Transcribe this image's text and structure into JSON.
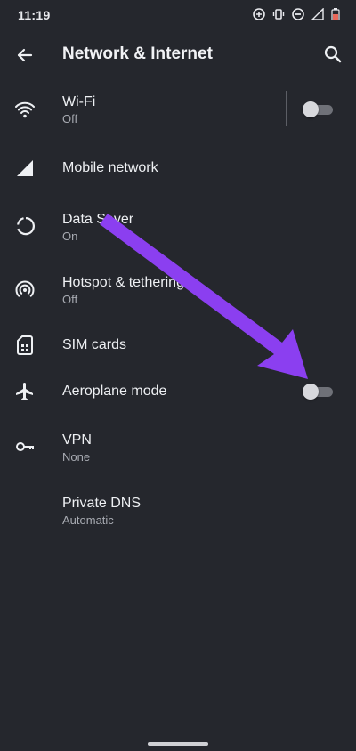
{
  "status_bar": {
    "time": "11:19",
    "icons": [
      "sync-icon",
      "vibrate-icon",
      "do-not-disturb-icon",
      "signal-icon",
      "battery-icon"
    ]
  },
  "app_bar": {
    "title": "Network & Internet",
    "back_icon": "arrow-back-icon",
    "search_icon": "search-icon"
  },
  "items": [
    {
      "label": "Wi-Fi",
      "sub": "Off",
      "icon": "wifi-icon",
      "toggle": false
    },
    {
      "label": "Mobile network",
      "sub": "",
      "icon": "cellular-icon"
    },
    {
      "label": "Data Saver",
      "sub": "On",
      "icon": "data-saver-icon"
    },
    {
      "label": "Hotspot & tethering",
      "sub": "Off",
      "icon": "hotspot-icon"
    },
    {
      "label": "SIM cards",
      "sub": "",
      "icon": "sim-card-icon"
    },
    {
      "label": "Aeroplane mode",
      "sub": "",
      "icon": "airplane-icon",
      "toggle": false
    },
    {
      "label": "VPN",
      "sub": "None",
      "icon": "vpn-key-icon"
    },
    {
      "label": "Private DNS",
      "sub": "Automatic",
      "icon": ""
    }
  ],
  "annotation": {
    "color": "#8b3ff0",
    "points_to": "Aeroplane mode toggle"
  },
  "colors": {
    "background": "#25272d",
    "text": "#eef0f3",
    "secondary_text": "#a8abb2",
    "toggle_off_track": "#6f7178"
  }
}
